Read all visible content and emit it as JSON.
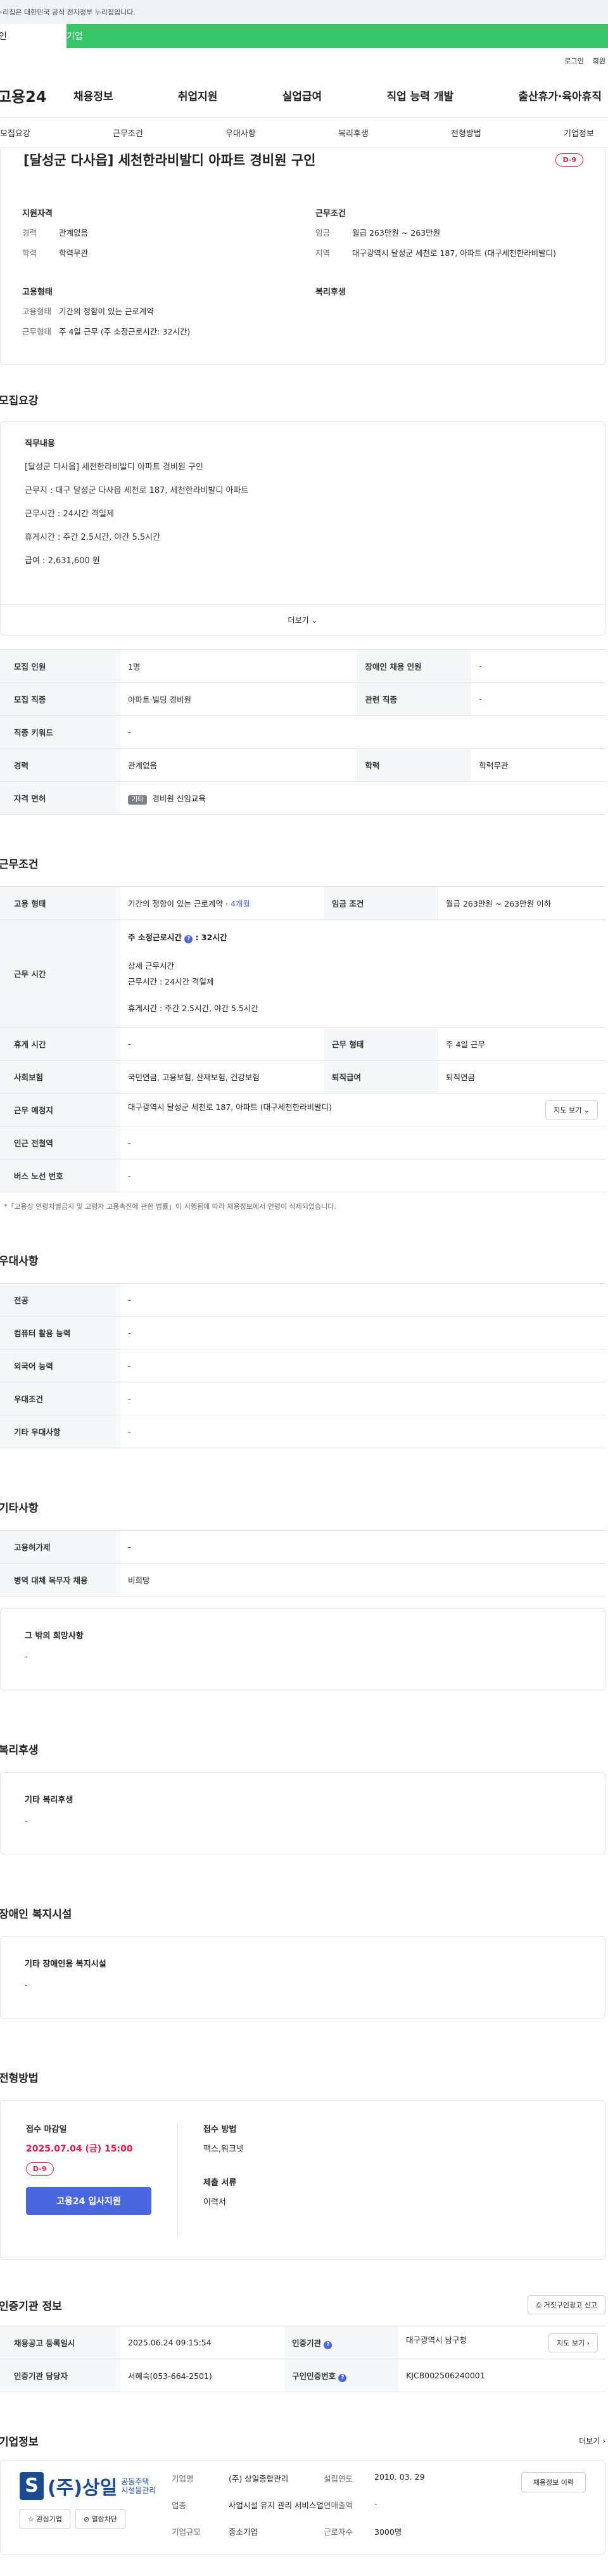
{
  "banner": {
    "text": "누리집은 대한민국 공식 전자정부 누리집입니다."
  },
  "top_tabs": [
    "인",
    "기업"
  ],
  "util": {
    "login": "로그인",
    "join": "회원"
  },
  "logo": "고용24",
  "gnb": [
    "채용정보",
    "취업지원",
    "실업급여",
    "직업 능력 개발",
    "출산휴가·육아휴직"
  ],
  "subnav": [
    "모집요강",
    "근무조건",
    "우대사항",
    "복리후생",
    "전형방법",
    "기업정보"
  ],
  "job": {
    "title": "[달성군 다사읍] 세천한라비발디 아파트 경비원 구인",
    "dday": "D-9"
  },
  "summary": {
    "req_h": "지원자격",
    "career_k": "경력",
    "career_v": "관계없음",
    "edu_k": "학력",
    "edu_v": "학력무관",
    "cond_h": "근무조건",
    "wage_k": "임금",
    "wage_v": "월급 263만원 ~ 263만원",
    "area_k": "지역",
    "area_v": "대구광역시 달성군 세천로 187, 아파트 (대구세천한라비발디)",
    "emp_h": "고용형태",
    "type_k": "고용형태",
    "type_v": "기간의 정함이 있는 근로계약",
    "hours_k": "근무형태",
    "hours_v": "주 4일 근무 (주 소정근로시간: 32시간)",
    "welfare_h": "복리후생"
  },
  "recruit": {
    "title": "모집요강",
    "lines": [
      "직무내용",
      "[달성군 다사읍] 세천한라비발디 아파트 경비원 구인",
      "근무지 : 대구 달성군 다사읍 세천로 187, 세천한라비발디 아파트",
      "근무시간 : 24시간 격일제",
      "휴게시간 : 주간 2.5시간, 야간 5.5시간",
      "급여 : 2,631,600 원"
    ],
    "more": "더보기",
    "rows": {
      "count_k": "모집 인원",
      "count_v": "1명",
      "disabled_k": "장애인 채용 인원",
      "disabled_v": "-",
      "job_k": "모집 직종",
      "job_v": "아파트·빌딩 경비원",
      "rel_k": "관련 직종",
      "rel_v": "-",
      "kw_k": "직종 키워드",
      "kw_v": "-",
      "career_k": "경력",
      "career_v": "관계없음",
      "edu_k": "학력",
      "edu_v": "학력무관",
      "license_k": "자격 면허",
      "license_tag": "기타",
      "license_v": "경비원 신임교육"
    }
  },
  "work": {
    "title": "근무조건",
    "type_k": "고용 형태",
    "type_v": "기간의 정함이 있는 근로계약",
    "type_months": "4개월",
    "wage_k": "임금 조건",
    "wage_v": "월급 263만원 ~ 263만원 이하",
    "time_k": "근무 시간",
    "time_total": "주 소정근로시간",
    "time_total_v": "32시간",
    "time_detail_h": "상세 근무시간",
    "time_detail": "근무시간 : 24시간 격일제",
    "time_rest": "휴게시간 : 주간 2.5시간, 야간 5.5시간",
    "rest_k": "휴게 시간",
    "rest_v": "-",
    "form_k": "근무 형태",
    "form_v": "주 4일 근무",
    "ins_k": "사회보험",
    "ins_v": "국민연금, 고용보험, 산재보험, 건강보험",
    "ret_k": "퇴직급여",
    "ret_v": "퇴직연금",
    "place_k": "근무 예정지",
    "place_v": "대구광역시 달성군 세천로 187, 아파트 (대구세천한라비발디)",
    "map_btn": "지도 보기",
    "subway_k": "인근 전철역",
    "subway_v": "-",
    "bus_k": "버스 노선 번호",
    "bus_v": "-",
    "note": "*「고용상 연령차별금지 및 고령자 고용촉진에 관한 법률」이 시행됨에 따라 채용정보에서 연령이 삭제되었습니다."
  },
  "pref": {
    "title": "우대사항",
    "rows": [
      {
        "k": "전공",
        "v": "-"
      },
      {
        "k": "컴퓨터 활용 능력",
        "v": "-"
      },
      {
        "k": "외국어 능력",
        "v": "-"
      },
      {
        "k": "우대조건",
        "v": "-"
      },
      {
        "k": "기타 우대사항",
        "v": "-"
      }
    ]
  },
  "etc": {
    "title": "기타사항",
    "rows": [
      {
        "k": "고용허가제",
        "v": "-"
      },
      {
        "k": "병역 대체 복무자 채용",
        "v": "비희망"
      }
    ],
    "box_h": "그 밖의 희망사항",
    "box_v": "-"
  },
  "welfare": {
    "title": "복리후생",
    "box_h": "기타 복리후생",
    "box_v": "-"
  },
  "disability": {
    "title": "장애인 복지시설",
    "box_h": "기타 장애인용 복지시설",
    "box_v": "-"
  },
  "selection": {
    "title": "전형방법",
    "deadline_h": "접수 마감일",
    "deadline_v": "2025.07.04 (금) 15:00",
    "dday": "D-9",
    "apply_btn": "고용24 입사지원",
    "method_h": "접수 방법",
    "method_v": "팩스,워크넷",
    "docs_h": "제출 서류",
    "docs_v": "이력서"
  },
  "cert": {
    "title": "인증기관 정보",
    "report_btn": "거짓구인광고 신고",
    "reg_k": "채용공고 등록일시",
    "reg_v": "2025.06.24 09:15:54",
    "org_k": "인증기관",
    "org_v": "대구광역시 남구청",
    "map_btn": "지도 보기",
    "mgr_k": "인증기관 담당자",
    "mgr_v": "서혜숙(053-664-2501)",
    "no_k": "구인인증번호",
    "no_v": "KJCB002506240001"
  },
  "company": {
    "title": "기업정보",
    "more": "더보기",
    "logo_big": "(주)상일",
    "logo_sm1": "공동주택",
    "logo_sm2": "시설물관리",
    "fav_btn": "관심기업",
    "block_btn": "열람차단",
    "name_k": "기업명",
    "name_v": "(주) 상일종합관리",
    "year_k": "설립연도",
    "year_v": "2010. 03. 29",
    "ind_k": "업종",
    "ind_v": "사업시설 유지 관리 서비스업",
    "sales_k": "연매출액",
    "sales_v": "-",
    "emp_k": "근로자수",
    "emp_v": "3000명",
    "size_k": "기업규모",
    "size_v": "중소기업",
    "jobs_btn": "채용정보 이력"
  }
}
